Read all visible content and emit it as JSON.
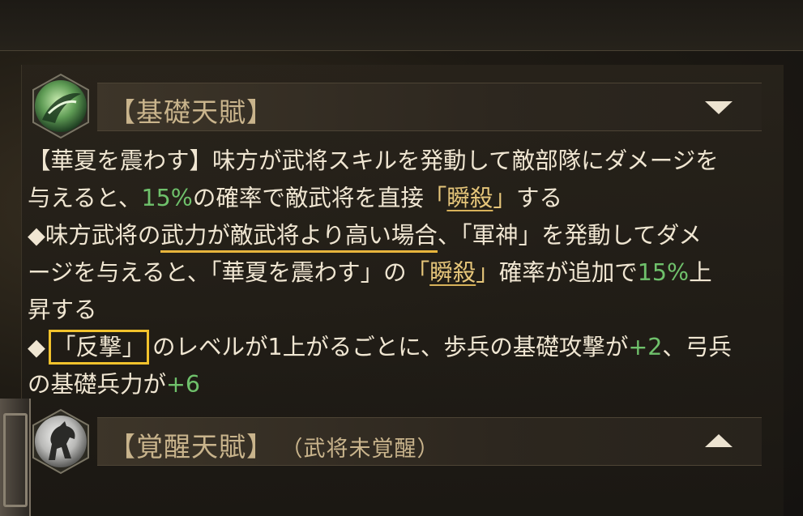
{
  "sections": [
    {
      "title": "【基礎天賦】",
      "icon": "green-spiral-weapon-icon",
      "toggle": "collapse",
      "description": {
        "line1": "【華夏を震わす】味方が武将スキルを発動して敵部隊にダメージを",
        "line2_a": "与えると、",
        "line2_pct": "15%",
        "line2_b": "の確率で敵武将を直接",
        "line2_q1": "「",
        "line2_kw": "瞬殺",
        "line2_q2": "」",
        "line2_c": "する",
        "line3_a": "◆味方武将の",
        "line3_u": "武力が敵武将より高い場合",
        "line3_b": "、「軍神」を発動してダメ",
        "line4_a": "ージを与えると、「華夏を震わす」の",
        "line4_q1": "「",
        "line4_kw": "瞬殺",
        "line4_q2": "」",
        "line4_b": "確率が追加で",
        "line4_pct": "15%",
        "line4_c": "上",
        "line5": "昇する",
        "line6_a": "◆ ",
        "line6_box": "「反撃」",
        "line6_b": " のレベルが1上がるごとに、歩兵の基礎攻撃が",
        "line6_v": "+2",
        "line6_c": "、弓兵",
        "line7_a": "の基礎兵力が",
        "line7_v": "+6"
      }
    },
    {
      "title": "【覚醒天賦】",
      "subtitle": "（武将未覚醒）",
      "icon": "white-horse-icon",
      "toggle": "expand"
    }
  ],
  "colors": {
    "accent_green": "#6fc16b",
    "keyword_gold": "#e6c67a",
    "highlight_box": "#f1c22c",
    "title_tan": "#c9b48c"
  }
}
